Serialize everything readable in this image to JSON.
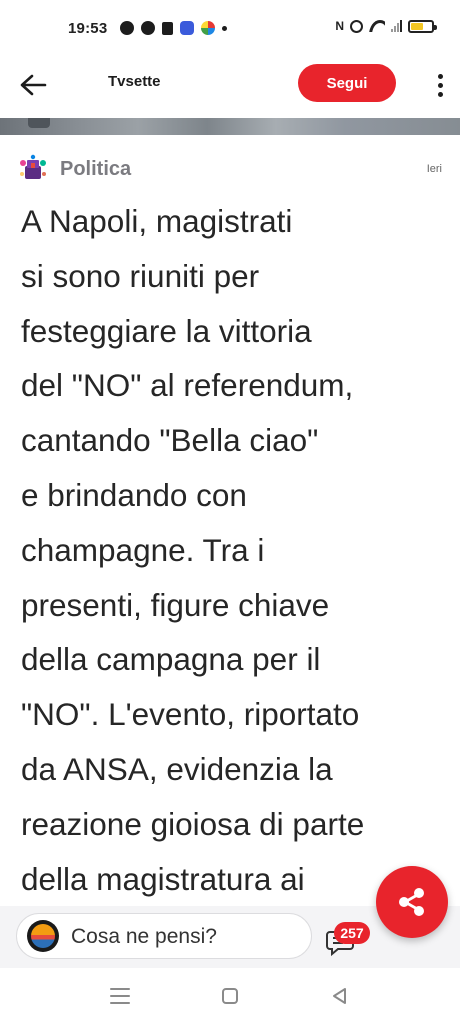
{
  "status_bar": {
    "time": "19:53",
    "left_icons": [
      "notification-app-icon",
      "messenger-icon",
      "trash-icon",
      "app-icon",
      "multicolor-app-icon",
      "dot-icon"
    ],
    "right_icons": [
      "nfc-icon",
      "alarm-icon",
      "wifi-icon",
      "signal-icon",
      "battery-icon"
    ],
    "nfc_label": "N",
    "battery_level": 0.6
  },
  "app_bar": {
    "source_title": "Tvsette",
    "follow_label": "Segui",
    "back_icon": "arrow-left-icon",
    "more_icon": "more-vertical-icon"
  },
  "article": {
    "category": "Politica",
    "date": "Ieri",
    "lines": [
      "A Napoli, magistrati",
      "si sono riuniti per",
      "festeggiare la vittoria",
      "del \"NO\" al referendum,",
      "cantando \"Bella ciao\"",
      "e brindando con",
      "champagne. Tra i",
      "presenti, figure chiave",
      "della campagna per il",
      "\"NO\". L'evento, riportato",
      "da ANSA, evidenzia la",
      "reazione gioiosa di parte",
      "della magistratura ai"
    ]
  },
  "comment_bar": {
    "placeholder": "Cosa ne pensi?",
    "comment_count": "257"
  },
  "colors": {
    "accent": "#e8242c",
    "category_text": "#7b7b80",
    "body_text": "#262626"
  }
}
